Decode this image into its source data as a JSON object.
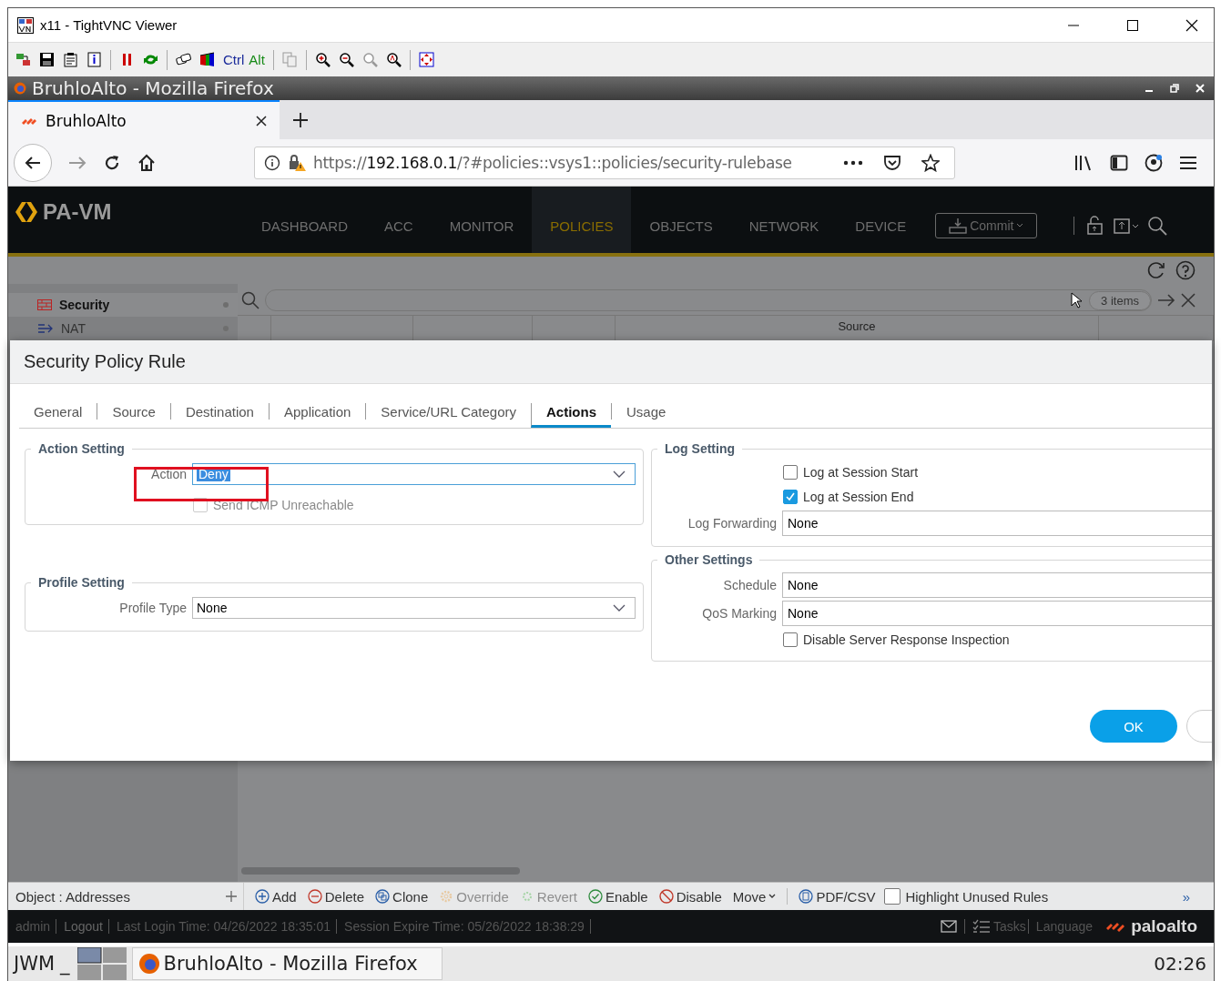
{
  "vnc_window": {
    "title": "x11 - TightVNC Viewer",
    "ctrl_key": "Ctrl",
    "alt_key": "Alt"
  },
  "browser": {
    "title": "BruhloAlto - Mozilla Firefox",
    "tab": {
      "label": "BruhloAlto",
      "selected": true
    },
    "url": "https://**192.168.0.1**/?#policies::vsys1::policies/security-rulebase"
  },
  "app": {
    "logo": "PA-VM",
    "nav": [
      {
        "label": "DASHBOARD",
        "selected": false
      },
      {
        "label": "ACC",
        "selected": false
      },
      {
        "label": "MONITOR",
        "selected": false
      },
      {
        "label": "POLICIES",
        "selected": true
      },
      {
        "label": "OBJECTS",
        "selected": false
      },
      {
        "label": "NETWORK",
        "selected": false
      },
      {
        "label": "DEVICE",
        "selected": false
      }
    ],
    "commit": "Commit"
  },
  "page": {
    "sidebar": [
      {
        "label": "Security",
        "selected": true
      },
      {
        "label": "NAT",
        "selected": false
      }
    ],
    "items_count": "3 items",
    "column_header": "Source"
  },
  "dialog": {
    "title": "Security Policy Rule",
    "tabs": [
      {
        "label": "General",
        "selected": false
      },
      {
        "label": "Source",
        "selected": false
      },
      {
        "label": "Destination",
        "selected": false
      },
      {
        "label": "Application",
        "selected": false
      },
      {
        "label": "Service/URL Category",
        "selected": false
      },
      {
        "label": "Actions",
        "selected": true
      },
      {
        "label": "Usage",
        "selected": false
      }
    ],
    "action_setting": {
      "legend": "Action Setting",
      "action_label": "Action",
      "action_value": "Deny",
      "value_selected": true,
      "send_icmp": {
        "label": "Send ICMP Unreachable",
        "checked": false,
        "disabled": true
      }
    },
    "profile_setting": {
      "legend": "Profile Setting",
      "label": "Profile Type",
      "value": "None"
    },
    "log_setting": {
      "legend": "Log Setting",
      "checkboxes": [
        {
          "label": "Log at Session Start",
          "checked": false
        },
        {
          "label": "Log at Session End",
          "checked": true
        }
      ],
      "forwarding_label": "Log Forwarding",
      "forwarding_value": "None"
    },
    "other_settings": {
      "legend": "Other Settings",
      "fields": [
        {
          "label": "Schedule",
          "value": "None"
        },
        {
          "label": "QoS Marking",
          "value": "None"
        }
      ],
      "checkbox": {
        "label": "Disable Server Response Inspection",
        "checked": false
      }
    },
    "ok": "OK"
  },
  "action_bar": {
    "object_label": "Object : Addresses",
    "buttons": [
      {
        "label": "Add",
        "disabled": false
      },
      {
        "label": "Delete",
        "disabled": false
      },
      {
        "label": "Clone",
        "disabled": false
      },
      {
        "label": "Override",
        "disabled": true
      },
      {
        "label": "Revert",
        "disabled": true
      },
      {
        "label": "Enable",
        "disabled": false
      },
      {
        "label": "Disable",
        "disabled": false
      }
    ],
    "move": "Move",
    "pdf": "PDF/CSV",
    "highlight": {
      "label": "Highlight Unused Rules",
      "checked": false
    },
    "more": "»"
  },
  "status_bar": {
    "items": [
      "admin",
      "Logout",
      "Last Login Time: 04/26/2022 18:35:01",
      "Session Expire Time: 05/26/2022 18:38:29"
    ],
    "tasks": "Tasks",
    "language": "Language",
    "brand": "paloalto"
  },
  "taskbar": {
    "menu": "JWM",
    "minimize": "_",
    "window": "BruhloAlto - Mozilla Firefox",
    "clock": "02:26"
  }
}
